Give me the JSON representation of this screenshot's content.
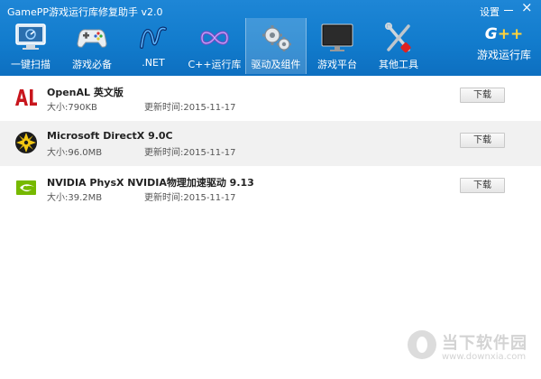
{
  "window": {
    "title": "GamePP游戏运行库修复助手 v2.0",
    "settings_label": "设置",
    "close_glyph": "×"
  },
  "nav": {
    "items": [
      {
        "label": "一键扫描",
        "icon": "monitor-scan-icon"
      },
      {
        "label": "游戏必备",
        "icon": "gamepad-icon"
      },
      {
        "label": ".NET",
        "icon": "dotnet-icon"
      },
      {
        "label": "C++运行库",
        "icon": "cpp-infinity-icon"
      },
      {
        "label": "驱动及组件",
        "icon": "gears-icon",
        "active": true
      },
      {
        "label": "游戏平台",
        "icon": "display-icon"
      },
      {
        "label": "其他工具",
        "icon": "tools-icon"
      }
    ]
  },
  "brand": {
    "logo_text": "G",
    "logo_accent": "++",
    "name": "游戏运行库"
  },
  "rows": [
    {
      "name": "OpenAL 英文版",
      "size": "大小:790KB",
      "updated": "更新时间:2015-11-17",
      "button": "下载",
      "icon": "openal-icon"
    },
    {
      "name": "Microsoft DirectX 9.0C",
      "size": "大小:96.0MB",
      "updated": "更新时间:2015-11-17",
      "button": "下载",
      "icon": "directx-icon"
    },
    {
      "name": "NVIDIA PhysX NVIDIA物理加速驱动 9.13",
      "size": "大小:39.2MB",
      "updated": "更新时间:2015-11-17",
      "button": "下载",
      "icon": "nvidia-icon"
    }
  ],
  "watermark": {
    "text": "当下软件园",
    "url": "www.downxia.com"
  },
  "colors": {
    "header": "#127ccd",
    "row_alt": "#f1f1f1",
    "openal_red": "#c8161d",
    "directx_yellow": "#f3c812",
    "nvidia_green": "#76b900"
  }
}
